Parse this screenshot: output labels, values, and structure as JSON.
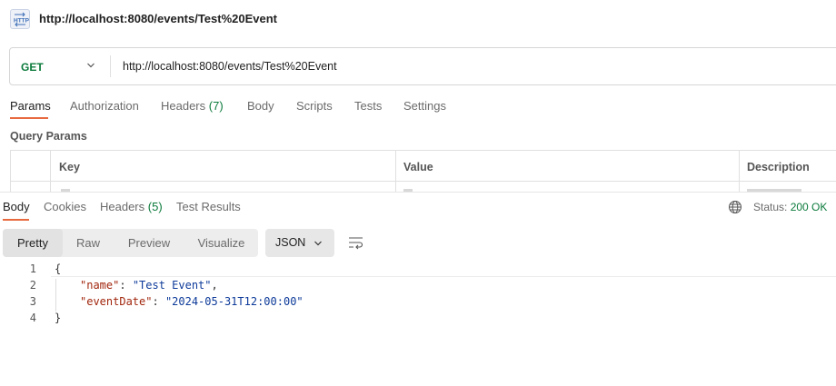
{
  "request": {
    "title": "http://localhost:8080/events/Test%20Event",
    "method": "GET",
    "url": "http://localhost:8080/events/Test%20Event",
    "icon": "http-file-icon"
  },
  "request_tabs": [
    {
      "label": "Params"
    },
    {
      "label": "Authorization"
    },
    {
      "label": "Headers",
      "count": "(7)"
    },
    {
      "label": "Body"
    },
    {
      "label": "Scripts"
    },
    {
      "label": "Tests"
    },
    {
      "label": "Settings"
    }
  ],
  "query_params": {
    "title": "Query Params",
    "columns": [
      "Key",
      "Value",
      "Description"
    ]
  },
  "response": {
    "tabs": [
      {
        "label": "Body"
      },
      {
        "label": "Cookies"
      },
      {
        "label": "Headers",
        "count": "(5)"
      },
      {
        "label": "Test Results"
      }
    ],
    "status_label": "Status:",
    "status_value": "200 OK",
    "views": [
      "Pretty",
      "Raw",
      "Preview",
      "Visualize"
    ],
    "format": "JSON",
    "code_lines": [
      {
        "n": "1",
        "text": "{"
      },
      {
        "n": "2",
        "key": "\"name\"",
        "value": "\"Test Event\"",
        "trail": ","
      },
      {
        "n": "3",
        "key": "\"eventDate\"",
        "value": "\"2024-05-31T12:00:00\"",
        "trail": ""
      },
      {
        "n": "4",
        "text": "}"
      }
    ]
  },
  "colors": {
    "accent": "#e8693f",
    "method_get": "#0b7a3b",
    "status_ok": "#0b7a3b",
    "json_key": "#a1260d",
    "json_string": "#0d3a99"
  }
}
